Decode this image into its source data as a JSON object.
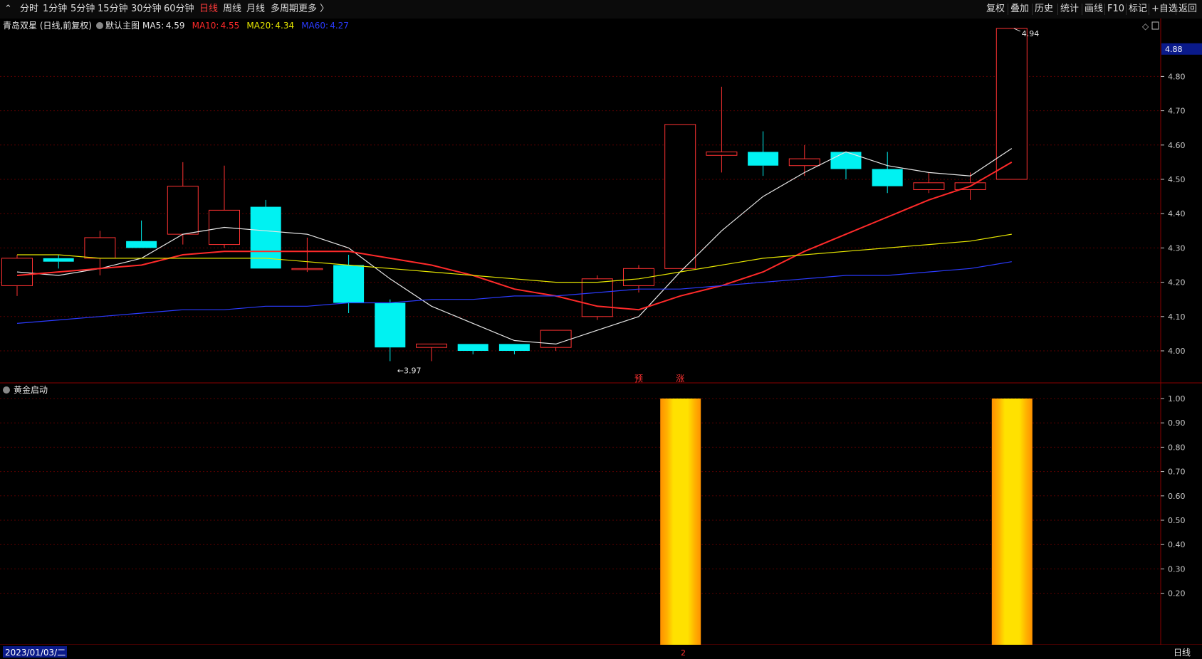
{
  "toolbar": {
    "left": [
      "分时",
      "1分钟",
      "5分钟",
      "15分钟",
      "30分钟",
      "60分钟",
      "日线",
      "周线",
      "月线",
      "多周期",
      "更多 〉"
    ],
    "active": "日线",
    "right": [
      "复权",
      "叠加",
      "历史",
      "统计",
      "画线",
      "F10",
      "标记",
      "+自选",
      "返回"
    ]
  },
  "main_header": {
    "title": "青岛双星 (日线,前复权)",
    "template": "默认主图",
    "ma": [
      {
        "label": "MA5:",
        "value": "4.59",
        "color": "#e6e6e6"
      },
      {
        "label": "MA10:",
        "value": "4.55",
        "color": "#ff2a2a"
      },
      {
        "label": "MA20:",
        "value": "4.34",
        "color": "#e6e600"
      },
      {
        "label": "MA60:",
        "value": "4.27",
        "color": "#2b3bff"
      }
    ]
  },
  "indicator_header": {
    "title": "黄金启动"
  },
  "footer": {
    "date": "2023/01/03/二",
    "period": "日线",
    "marker": "2"
  },
  "colors": {
    "up": "#ff3232",
    "down": "#00f2f2",
    "bg": "#000000",
    "grid": "#5a0000",
    "axis": "#c8c8c8",
    "bar_yellow": "#ffe100",
    "bar_orange": "#ff9e00"
  },
  "chart_data": [
    {
      "type": "candlestick",
      "y_ticks": [
        "4.00",
        "4.10",
        "4.20",
        "4.30",
        "4.40",
        "4.50",
        "4.60",
        "4.70",
        "4.80"
      ],
      "ylim": [
        3.94,
        4.93
      ],
      "last_price": "4.88",
      "high_label": "4.94",
      "low_label": "3.97",
      "candles": [
        {
          "o": 4.19,
          "h": 4.28,
          "l": 4.16,
          "c": 4.27
        },
        {
          "o": 4.27,
          "h": 4.28,
          "l": 4.24,
          "c": 4.26
        },
        {
          "o": 4.27,
          "h": 4.35,
          "l": 4.22,
          "c": 4.33
        },
        {
          "o": 4.32,
          "h": 4.38,
          "l": 4.3,
          "c": 4.3
        },
        {
          "o": 4.34,
          "h": 4.55,
          "l": 4.31,
          "c": 4.48
        },
        {
          "o": 4.31,
          "h": 4.54,
          "l": 4.3,
          "c": 4.41
        },
        {
          "o": 4.42,
          "h": 4.44,
          "l": 4.24,
          "c": 4.24
        },
        {
          "o": 4.24,
          "h": 4.33,
          "l": 4.23,
          "c": 4.24
        },
        {
          "o": 4.25,
          "h": 4.28,
          "l": 4.11,
          "c": 4.14
        },
        {
          "o": 4.14,
          "h": 4.15,
          "l": 3.97,
          "c": 4.01
        },
        {
          "o": 4.01,
          "h": 4.02,
          "l": 3.97,
          "c": 4.02
        },
        {
          "o": 4.02,
          "h": 4.02,
          "l": 3.99,
          "c": 4.0
        },
        {
          "o": 4.02,
          "h": 4.02,
          "l": 3.99,
          "c": 4.0
        },
        {
          "o": 4.01,
          "h": 4.06,
          "l": 4.0,
          "c": 4.06
        },
        {
          "o": 4.1,
          "h": 4.22,
          "l": 4.09,
          "c": 4.21
        },
        {
          "o": 4.19,
          "h": 4.25,
          "l": 4.17,
          "c": 4.24
        },
        {
          "o": 4.24,
          "h": 4.66,
          "l": 4.24,
          "c": 4.66
        },
        {
          "o": 4.57,
          "h": 4.77,
          "l": 4.52,
          "c": 4.58
        },
        {
          "o": 4.58,
          "h": 4.64,
          "l": 4.51,
          "c": 4.54
        },
        {
          "o": 4.54,
          "h": 4.6,
          "l": 4.51,
          "c": 4.56
        },
        {
          "o": 4.58,
          "h": 4.58,
          "l": 4.5,
          "c": 4.53
        },
        {
          "o": 4.53,
          "h": 4.58,
          "l": 4.46,
          "c": 4.48
        },
        {
          "o": 4.47,
          "h": 4.52,
          "l": 4.46,
          "c": 4.49
        },
        {
          "o": 4.47,
          "h": 4.52,
          "l": 4.44,
          "c": 4.49
        },
        {
          "o": 4.5,
          "h": 4.94,
          "l": 4.5,
          "c": 4.94
        }
      ],
      "series": [
        {
          "name": "MA5",
          "color": "#e6e6e6",
          "values": [
            4.23,
            4.22,
            4.24,
            4.27,
            4.34,
            4.36,
            4.35,
            4.34,
            4.3,
            4.21,
            4.13,
            4.08,
            4.03,
            4.02,
            4.06,
            4.1,
            4.23,
            4.35,
            4.45,
            4.52,
            4.58,
            4.54,
            4.52,
            4.51,
            4.59
          ]
        },
        {
          "name": "MA10",
          "color": "#ff2a2a",
          "values": [
            4.22,
            4.23,
            4.24,
            4.25,
            4.28,
            4.29,
            4.29,
            4.29,
            4.29,
            4.27,
            4.25,
            4.22,
            4.18,
            4.16,
            4.13,
            4.12,
            4.16,
            4.19,
            4.23,
            4.29,
            4.34,
            4.39,
            4.44,
            4.48,
            4.55
          ]
        },
        {
          "name": "MA20",
          "color": "#e6e600",
          "values": [
            4.28,
            4.28,
            4.27,
            4.27,
            4.27,
            4.27,
            4.27,
            4.26,
            4.25,
            4.24,
            4.23,
            4.22,
            4.21,
            4.2,
            4.2,
            4.21,
            4.23,
            4.25,
            4.27,
            4.28,
            4.29,
            4.3,
            4.31,
            4.32,
            4.34
          ]
        },
        {
          "name": "MA60",
          "color": "#2b3bff",
          "values": [
            4.08,
            4.09,
            4.1,
            4.11,
            4.12,
            4.12,
            4.13,
            4.13,
            4.14,
            4.14,
            4.15,
            4.15,
            4.16,
            4.16,
            4.17,
            4.18,
            4.18,
            4.19,
            4.2,
            4.21,
            4.22,
            4.22,
            4.23,
            4.24,
            4.26
          ]
        }
      ],
      "signals": [
        {
          "index": 15,
          "text": "预"
        },
        {
          "index": 16,
          "text": "涨"
        }
      ]
    },
    {
      "type": "bar",
      "title": "黄金启动",
      "y_ticks": [
        "0.20",
        "0.30",
        "0.40",
        "0.50",
        "0.60",
        "0.70",
        "0.80",
        "0.90",
        "1.00"
      ],
      "ylim": [
        0.0,
        1.0
      ],
      "values": [
        0,
        0,
        0,
        0,
        0,
        0,
        0,
        0,
        0,
        0,
        0,
        0,
        0,
        0,
        0,
        0,
        1,
        0,
        0,
        0,
        0,
        0,
        0,
        0,
        1
      ]
    }
  ]
}
